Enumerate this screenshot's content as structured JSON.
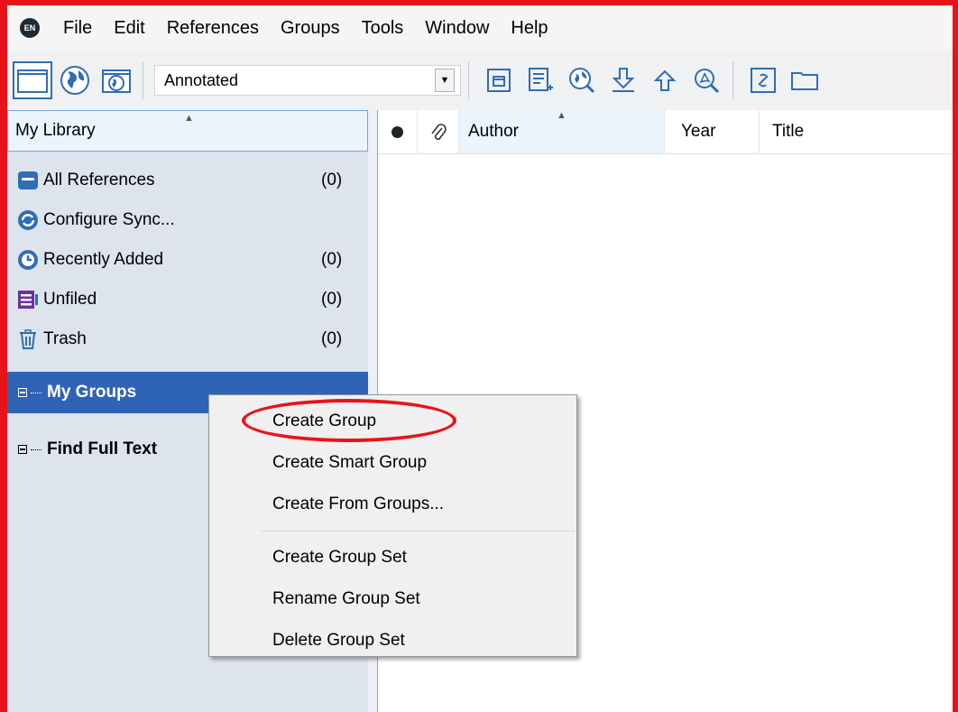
{
  "menu": {
    "items": [
      "File",
      "Edit",
      "References",
      "Groups",
      "Tools",
      "Window",
      "Help"
    ]
  },
  "toolbar": {
    "style_select_value": "Annotated"
  },
  "library": {
    "header": "My Library",
    "items": [
      {
        "label": "All References",
        "count": "(0)",
        "icon": "all-references-icon"
      },
      {
        "label": "Configure Sync...",
        "count": "",
        "icon": "sync-icon"
      },
      {
        "label": "Recently Added",
        "count": "(0)",
        "icon": "recently-added-icon"
      },
      {
        "label": "Unfiled",
        "count": "(0)",
        "icon": "unfiled-icon"
      },
      {
        "label": "Trash",
        "count": "(0)",
        "icon": "trash-icon"
      }
    ],
    "groups_label": "My Groups",
    "find_full_text_label": "Find Full Text"
  },
  "columns": {
    "author": "Author",
    "year": "Year",
    "title": "Title"
  },
  "context_menu": {
    "items": [
      "Create Group",
      "Create Smart Group",
      "Create From Groups..."
    ],
    "items2": [
      "Create Group Set",
      "Rename Group Set",
      "Delete Group Set"
    ],
    "highlighted": "Create Group"
  },
  "colors": {
    "annotation_red": "#e8131a",
    "selection_blue": "#2f63b6",
    "accent_blue": "#2f6db5",
    "unfiled_purple": "#6b2fa0"
  }
}
